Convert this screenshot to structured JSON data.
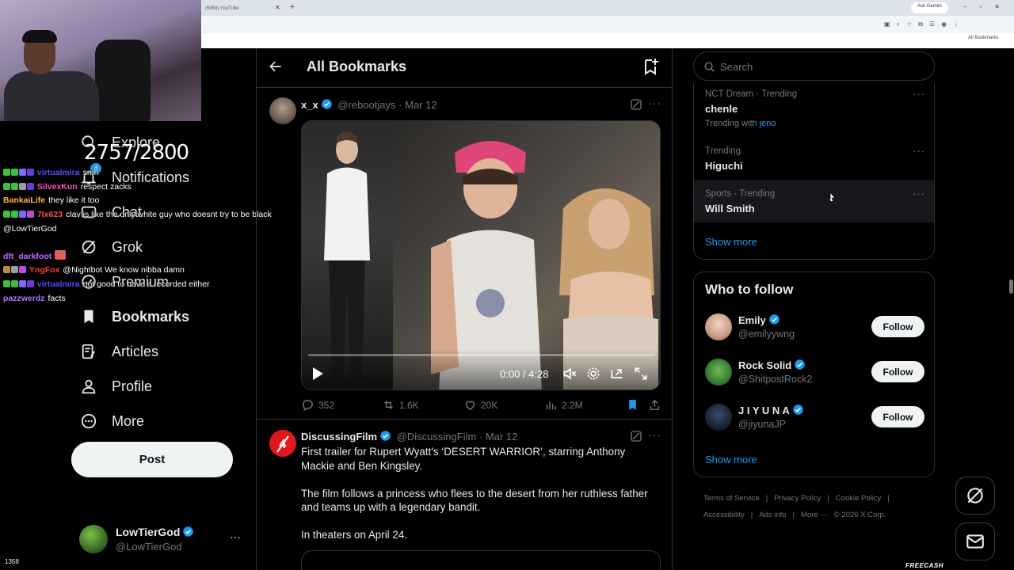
{
  "browser": {
    "tab_title": "(6958) YouTube",
    "gemini_label": "Ask Gemini",
    "bookmarks_label": "All Bookmarks"
  },
  "overlay": {
    "counter": "2757/2800",
    "viewer_count": "1358",
    "chat": [
      {
        "user": "virtualmira",
        "text": "smh",
        "color": "#5a4cff"
      },
      {
        "user": "SilvexKun",
        "text": "respect zacks",
        "color": "#ff4fbf"
      },
      {
        "user": "BankaiLife",
        "text": "they like it too",
        "color": "#ffb347"
      },
      {
        "user": "7lx623",
        "text": "clav is like the only white guy who doesnt try to be black @LowTierGod",
        "color": "#ff4f4f"
      },
      {
        "user": "dft_darkfoot",
        "text": "",
        "color": "#c06bff"
      },
      {
        "user": "YngFox",
        "text": "@Nightbot We know nibba damn",
        "color": "#ff3b3b"
      },
      {
        "user": "virtualmira",
        "text": "not good to have it recorded either",
        "color": "#5a4cff"
      },
      {
        "user": "pazzwerdz",
        "text": "facts",
        "color": "#b07aff"
      }
    ]
  },
  "nav": {
    "items": [
      {
        "label": "Explore",
        "icon": "search-icon"
      },
      {
        "label": "Notifications",
        "icon": "bell-icon",
        "badge": "4"
      },
      {
        "label": "Chat",
        "icon": "chat-icon"
      },
      {
        "label": "Grok",
        "icon": "grok-icon"
      },
      {
        "label": "Premium",
        "icon": "verified-icon"
      },
      {
        "label": "Bookmarks",
        "icon": "bookmark-icon"
      },
      {
        "label": "Articles",
        "icon": "article-icon"
      },
      {
        "label": "Profile",
        "icon": "person-icon"
      },
      {
        "label": "More",
        "icon": "more-circle-icon"
      }
    ],
    "post_label": "Post"
  },
  "profile": {
    "name": "LowTierGod",
    "handle": "@LowTierGod",
    "more": "···"
  },
  "main": {
    "title": "All Bookmarks",
    "tweets": [
      {
        "name": "x_x",
        "handle": "@rebootjays",
        "dot": "·",
        "date": "Mar 12",
        "video_time": "0:00 / 4:28",
        "replies": "352",
        "reposts": "1.6K",
        "likes": "20K",
        "views": "2.2M"
      },
      {
        "name": "DiscussingFilm",
        "handle": "@DiscussingFilm",
        "dot": "·",
        "date": "Mar 12",
        "body": [
          "First trailer for Rupert Wyatt's ‘DESERT WARRIOR’, starring Anthony Mackie and Ben Kingsley.",
          "The film follows a princess who flees to the desert from her ruthless father and teams up with a legendary bandit.",
          "In theaters on April 24."
        ]
      }
    ]
  },
  "sidebar": {
    "search_placeholder": "Search",
    "trends": [
      {
        "meta": "NCT Dream · Trending",
        "title": "chenle",
        "sub_prefix": "Trending with",
        "sub_link": "jeno"
      },
      {
        "meta": "Trending",
        "title": "Higuchi"
      },
      {
        "meta": "Sports · Trending",
        "title": "Will Smith"
      }
    ],
    "trends_show_more": "Show more",
    "who_to_follow_title": "Who to follow",
    "follow": [
      {
        "name": "Emily",
        "handle": "@emilyywng"
      },
      {
        "name": "Rock Solid",
        "handle": "@ShitpostRock2"
      },
      {
        "name": "J I Y U N A",
        "handle": "@jiyunaJP"
      }
    ],
    "follow_label": "Follow",
    "follow_show_more": "Show more",
    "footer": [
      "Terms of Service",
      "Privacy Policy",
      "Cookie Policy",
      "Accessibility",
      "Ads info",
      "More ···",
      "© 2026 X Corp."
    ]
  },
  "watermark": "FREECASH"
}
